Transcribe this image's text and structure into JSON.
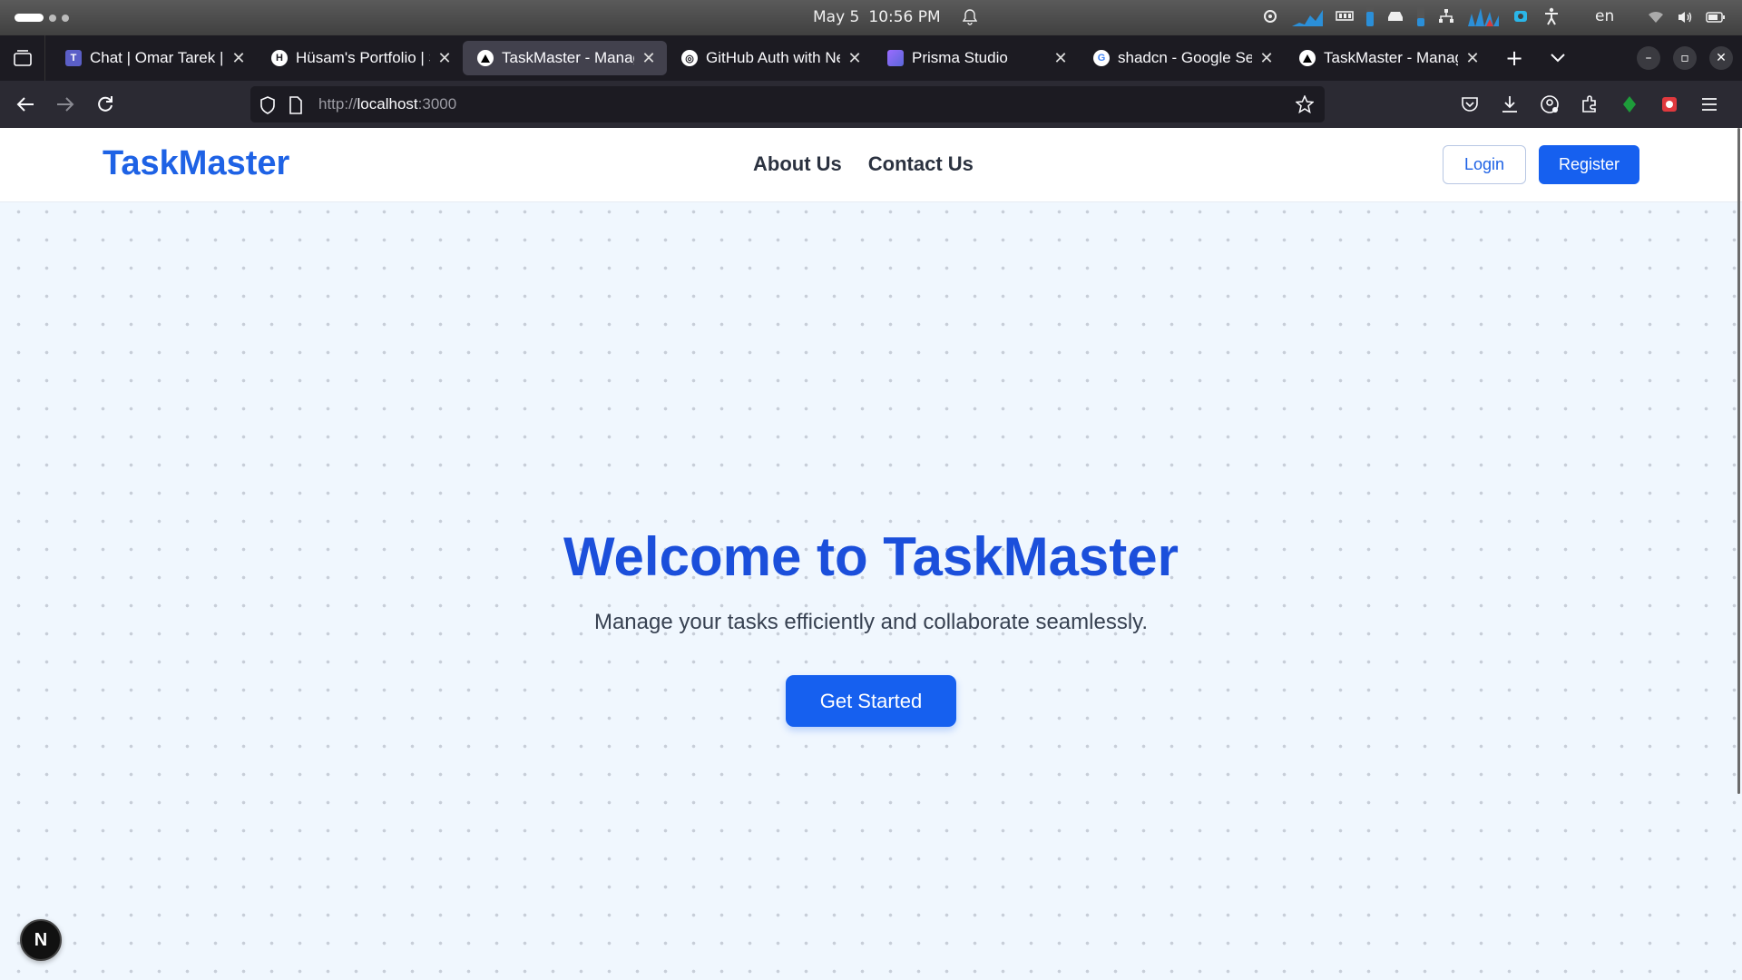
{
  "system_bar": {
    "date": "May 5",
    "time": "10:56 PM",
    "language": "en"
  },
  "browser": {
    "tabs": [
      {
        "label": "Chat | Omar Tarek | I",
        "icon": "teams-icon",
        "active": false
      },
      {
        "label": "Hüsam's Portfolio | S",
        "icon": "portfolio-h-icon",
        "active": false
      },
      {
        "label": "TaskMaster - Manag",
        "icon": "vercel-triangle-icon",
        "active": true
      },
      {
        "label": "GitHub Auth with Ne",
        "icon": "openai-icon",
        "active": false
      },
      {
        "label": "Prisma Studio",
        "icon": "prisma-icon",
        "active": false
      },
      {
        "label": "shadcn - Google Sea",
        "icon": "google-icon",
        "active": false
      },
      {
        "label": "TaskMaster - Manag",
        "icon": "vercel-triangle-icon",
        "active": false
      }
    ],
    "url_scheme": "http://",
    "url_host": "localhost",
    "url_port": ":3000"
  },
  "site": {
    "brand": "TaskMaster",
    "nav": {
      "about": "About Us",
      "contact": "Contact Us"
    },
    "login_label": "Login",
    "register_label": "Register"
  },
  "hero": {
    "title": "Welcome to TaskMaster",
    "subtitle": "Manage your tasks efficiently and collaborate seamlessly.",
    "cta_label": "Get Started"
  },
  "devtools_badge": "N",
  "colors": {
    "brand_blue": "#1e62e5",
    "primary_button": "#1660ef",
    "page_background": "#f0f7fe"
  }
}
